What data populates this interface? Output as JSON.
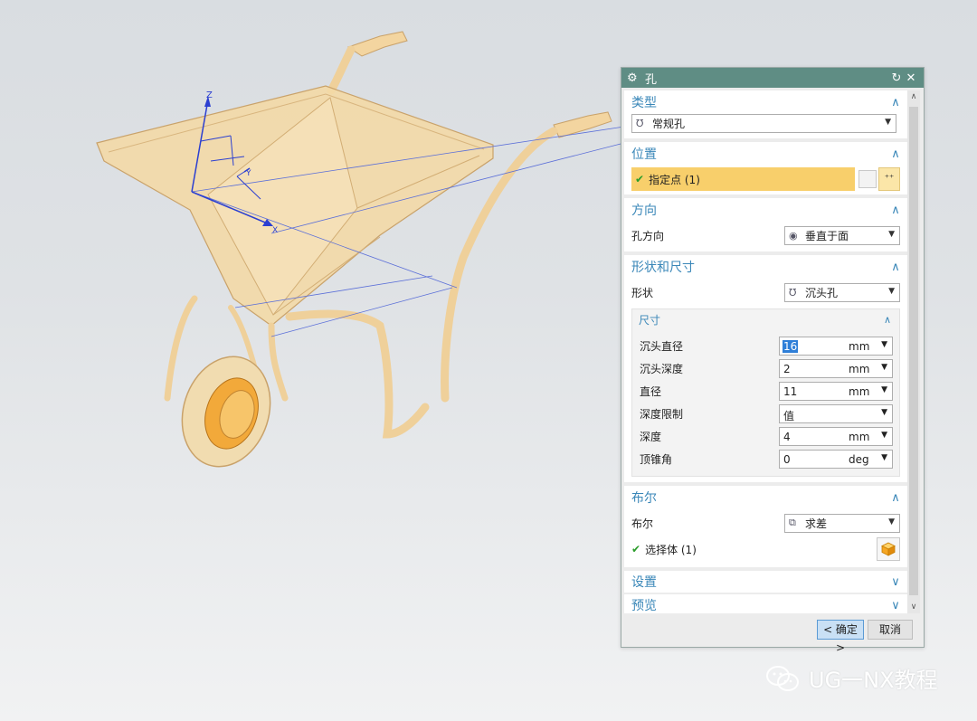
{
  "dialog": {
    "title": "孔",
    "sections": {
      "type": {
        "header": "类型",
        "selected": "常规孔"
      },
      "position": {
        "header": "位置",
        "point_label": "指定点 (1)"
      },
      "direction": {
        "header": "方向",
        "label": "孔方向",
        "selected": "垂直于面"
      },
      "shape": {
        "header": "形状和尺寸",
        "label": "形状",
        "selected": "沉头孔",
        "dimensions": {
          "header": "尺寸",
          "rows": [
            {
              "label": "沉头直径",
              "value": "16",
              "unit": "mm"
            },
            {
              "label": "沉头深度",
              "value": "2",
              "unit": "mm"
            },
            {
              "label": "直径",
              "value": "11",
              "unit": "mm"
            },
            {
              "label": "深度限制",
              "value": "值",
              "unit": ""
            },
            {
              "label": "深度",
              "value": "4",
              "unit": "mm"
            },
            {
              "label": "顶锥角",
              "value": "0",
              "unit": "deg"
            }
          ]
        }
      },
      "boolean": {
        "header": "布尔",
        "label": "布尔",
        "selected": "求差",
        "select_body": "选择体 (1)"
      },
      "settings": {
        "header": "设置"
      },
      "preview": {
        "header": "预览"
      }
    },
    "buttons": {
      "ok": "< 确定 >",
      "cancel": "取消"
    }
  },
  "viewport": {
    "axes": {
      "z": "Z",
      "y": "Y",
      "x": "X"
    }
  },
  "watermark": "UG一NX教程",
  "colors": {
    "title_bar": "#5f8d84",
    "section_header": "#3a87b8",
    "highlight": "#f8cf6b",
    "model": "#f3d9a6"
  }
}
